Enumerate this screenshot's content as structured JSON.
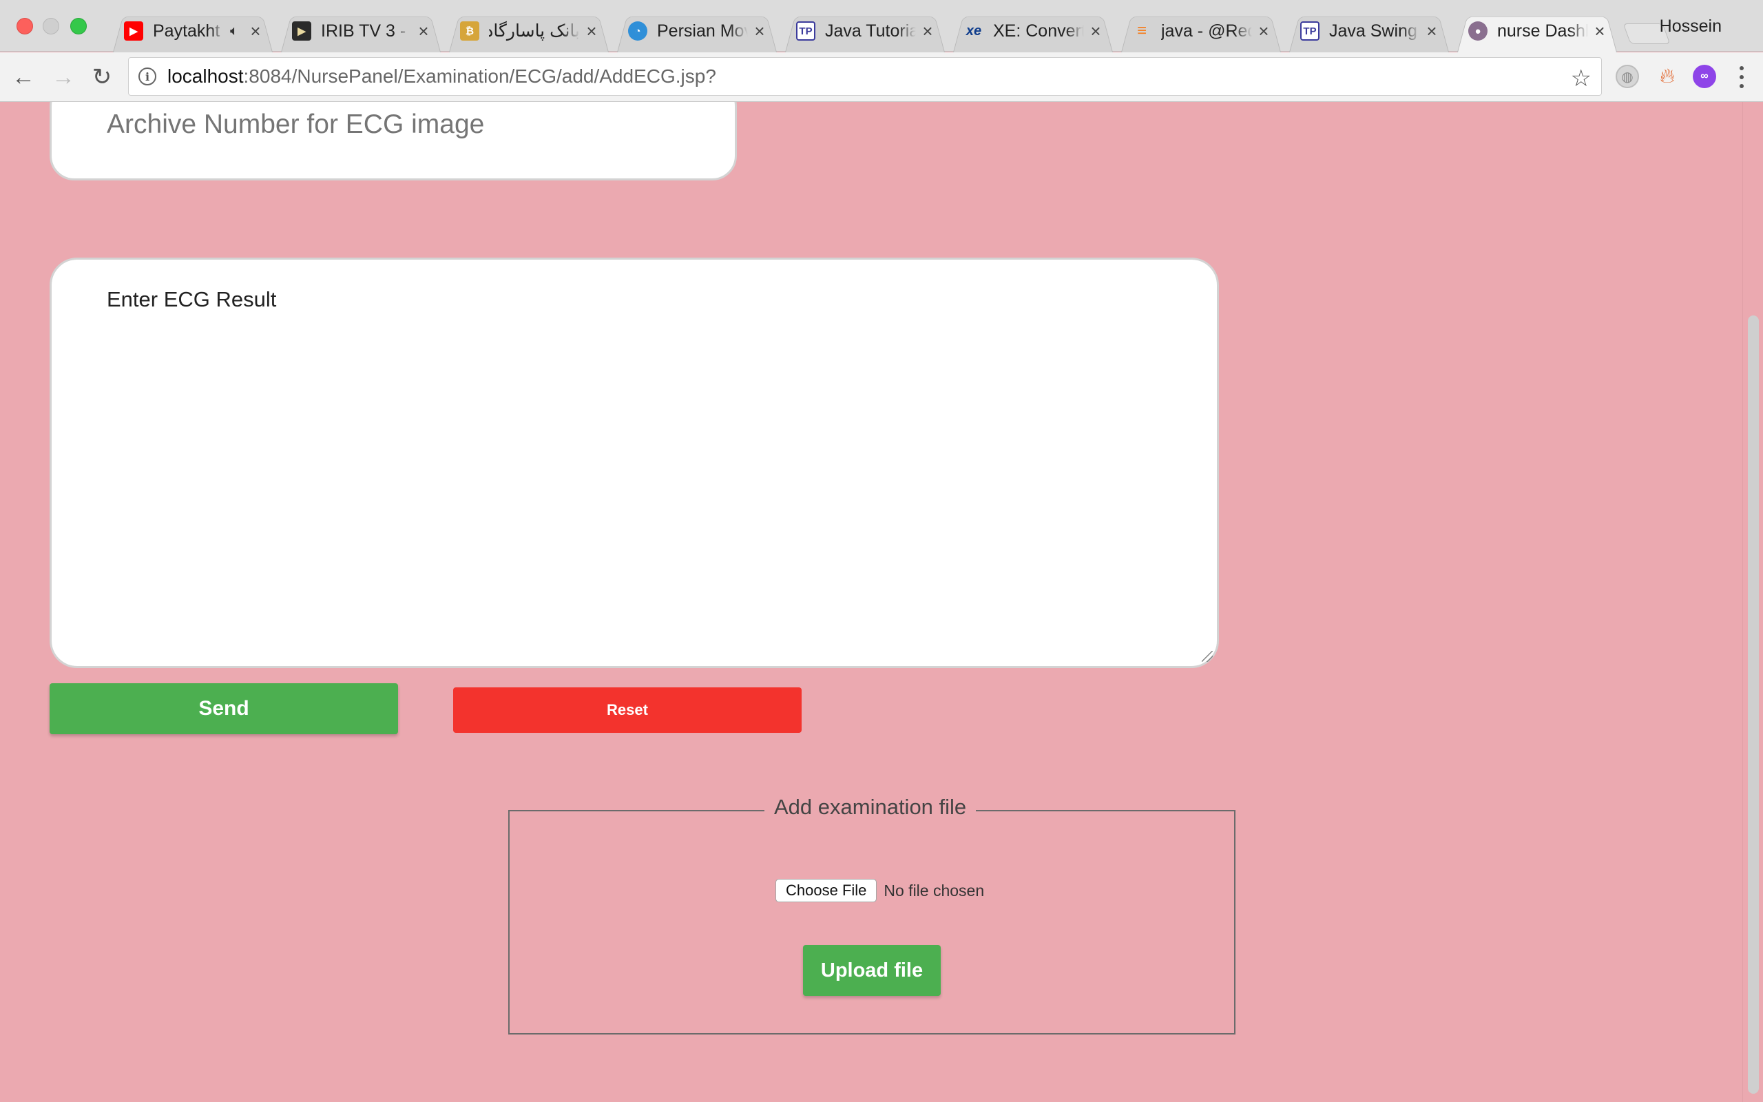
{
  "browser": {
    "profile_name": "Hossein",
    "tabs": [
      {
        "title": "Paytakht",
        "favicon": "youtube-icon",
        "favicon_color": "#ff0000",
        "audio": true
      },
      {
        "title": "IRIB TV 3 - ",
        "favicon": "play-icon",
        "favicon_color": "#2b2b2b",
        "audio": false
      },
      {
        "title": "بانک پاسارگاد ::",
        "favicon": "bank-icon",
        "favicon_color": "#d6a53a",
        "audio": false
      },
      {
        "title": "Persian Mov",
        "favicon": "swirl-icon",
        "favicon_color": "#2f8fd8",
        "audio": false
      },
      {
        "title": "Java Tutoria",
        "favicon": "tutorial-icon",
        "favicon_color": "#3b3b9c",
        "audio": false
      },
      {
        "title": "XE: Convert",
        "favicon": "xe-icon",
        "favicon_color": "#0f3d8c",
        "audio": false
      },
      {
        "title": "java - @Req",
        "favicon": "stackoverflow-icon",
        "favicon_color": "#f48024",
        "audio": false
      },
      {
        "title": "Java Swing",
        "favicon": "tutorial-icon",
        "favicon_color": "#3b3b9c",
        "audio": false
      },
      {
        "title": "nurse Dashb",
        "favicon": "avatar-icon",
        "favicon_color": "#8a6f8f",
        "audio": false,
        "active": true
      }
    ],
    "url_host": "localhost",
    "url_path": ":8084/NursePanel/Examination/ECG/add/AddECG.jsp?"
  },
  "form": {
    "archive_placeholder": "Archive Number for ECG image",
    "result_placeholder": "Enter ECG Result",
    "send_label": "Send",
    "reset_label": "Reset"
  },
  "upload": {
    "legend": "Add examination file",
    "choose_label": "Choose File",
    "no_file_text": "No file chosen",
    "upload_label": "Upload file"
  },
  "colors": {
    "page_bg": "#eba9b0",
    "send_green": "#4caf50",
    "reset_red": "#f3332d"
  }
}
